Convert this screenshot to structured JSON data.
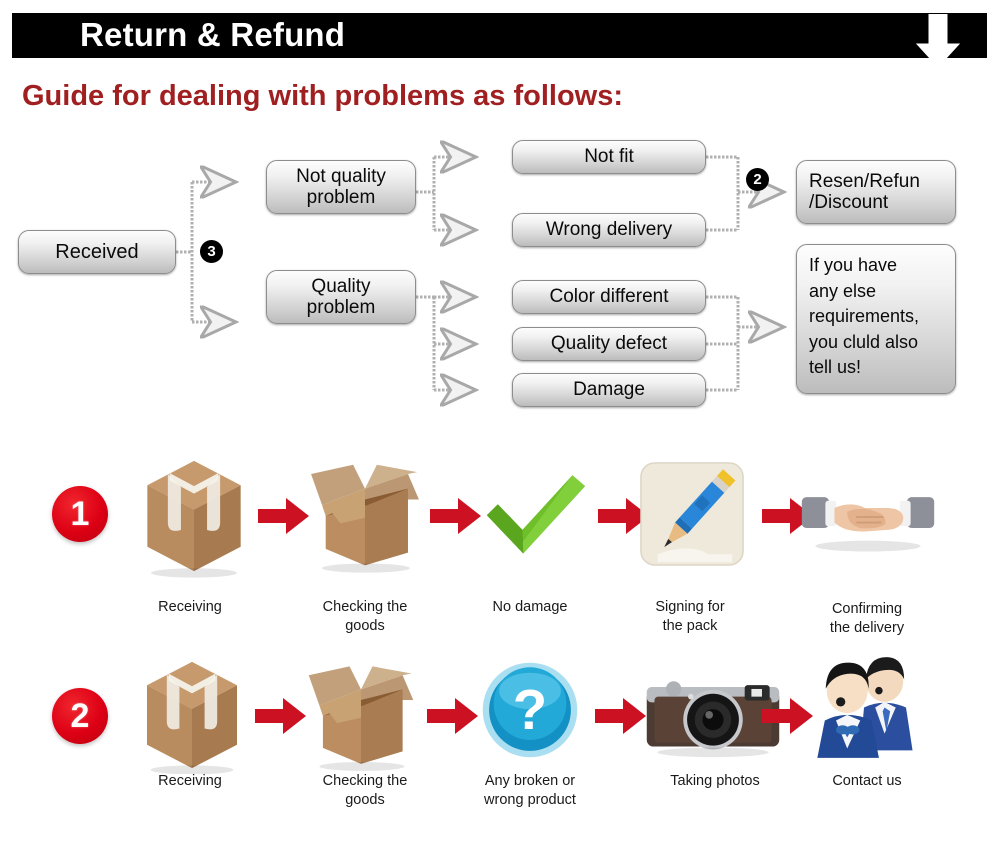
{
  "header": {
    "title": "Return & Refund",
    "arrow_icon": "down-arrow-icon",
    "background_color": "#000000",
    "text_color": "#ffffff"
  },
  "guide": {
    "title": "Guide for dealing with problems as follows:",
    "color": "#A01F20"
  },
  "flowchart": {
    "start_node": "Received",
    "badge_3": "3",
    "badge_2": "2",
    "branch_nodes": [
      {
        "label": "Not quality\nproblem",
        "line1": "Not quality",
        "line2": "problem"
      },
      {
        "label": "Quality\nproblem",
        "line1": "Quality",
        "line2": "problem"
      }
    ],
    "not_quality_children": [
      "Not fit",
      "Wrong delivery"
    ],
    "quality_children": [
      "Color different",
      "Quality defect",
      "Damage"
    ],
    "outcome_node": {
      "line1": "Resen/Refun",
      "line2": "/Discount"
    },
    "note_node": {
      "line1": "If you have",
      "line2": "any else",
      "line3": "requirements,",
      "line4": "you cluld also",
      "line5": "tell us!"
    }
  },
  "steps": {
    "row1": {
      "number": "1",
      "items": [
        {
          "icon": "closed-box-icon",
          "caption_line1": "Receiving",
          "caption_line2": ""
        },
        {
          "icon": "open-box-icon",
          "caption_line1": "Checking the",
          "caption_line2": "goods"
        },
        {
          "icon": "green-check-icon",
          "caption_line1": "No damage",
          "caption_line2": ""
        },
        {
          "icon": "pencil-signing-icon",
          "caption_line1": "Signing for",
          "caption_line2": "the pack"
        },
        {
          "icon": "handshake-icon",
          "caption_line1": "Confirming",
          "caption_line2": "the delivery"
        }
      ]
    },
    "row2": {
      "number": "2",
      "items": [
        {
          "icon": "closed-box-icon",
          "caption_line1": "Receiving",
          "caption_line2": ""
        },
        {
          "icon": "open-box-icon",
          "caption_line1": "Checking the",
          "caption_line2": "goods"
        },
        {
          "icon": "blue-question-icon",
          "caption_line1": "Any broken or",
          "caption_line2": "wrong product"
        },
        {
          "icon": "camera-icon",
          "caption_line1": "Taking photos",
          "caption_line2": ""
        },
        {
          "icon": "support-agents-icon",
          "caption_line1": "Contact us",
          "caption_line2": ""
        }
      ]
    },
    "arrow_icon": "red-right-arrow-icon",
    "arrow_color": "#CC1122"
  },
  "colors": {
    "red_accent": "#DD0014",
    "dark_red_heading": "#A01F20",
    "flow_node_border": "#8d8d8d",
    "connector": "#b5b5b5"
  }
}
